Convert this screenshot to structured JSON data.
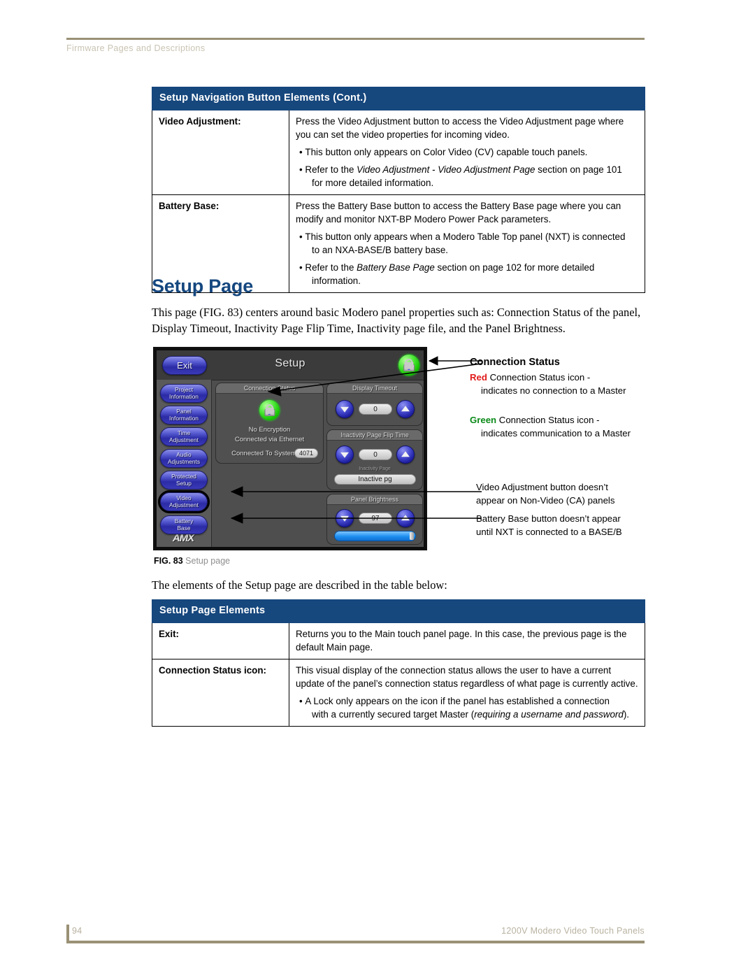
{
  "header": {
    "running_head": "Firmware Pages and Descriptions"
  },
  "footer": {
    "page_number": "94",
    "doc_title": "1200V Modero Video Touch Panels"
  },
  "table_top": {
    "header": "Setup Navigation Button Elements (Cont.)",
    "rows": [
      {
        "label": "Video Adjustment:",
        "paragraphs": [
          "Press the Video Adjustment button to access the Video Adjustment page where you can set the video properties for incoming video."
        ],
        "bullets": [
          {
            "text": "This button only appears on Color Video (CV) capable touch panels."
          },
          {
            "pre": "Refer to the ",
            "italic": "Video Adjustment - Video Adjustment Page",
            "post": " section on page 101",
            "cont": "for more detailed information."
          }
        ]
      },
      {
        "label": "Battery Base:",
        "paragraphs": [
          "Press the Battery Base button to access the Battery Base page where you can modify and monitor NXT-BP Modero Power Pack parameters."
        ],
        "bullets": [
          {
            "text": "This button only appears when a Modero Table Top panel (NXT) is connected",
            "cont": "to an NXA-BASE/B battery base."
          },
          {
            "pre": "Refer to the ",
            "italic": "Battery Base Page",
            "post": " section on page 102 for more detailed",
            "cont": "information."
          }
        ]
      }
    ]
  },
  "section": {
    "heading": "Setup Page",
    "intro": "This page (FIG. 83) centers around basic Modero panel properties such as: Connection Status of the panel, Display Timeout, Inactivity Page Flip Time, Inactivity page file, and the Panel Brightness.",
    "table_lead": "The elements of the Setup page are described in the table below:"
  },
  "figure": {
    "caption_label": "FIG. 83",
    "caption_text": "Setup page",
    "panel": {
      "exit_button": "Exit",
      "title": "Setup",
      "status_lock_icon": "green-lock-icon",
      "nav_buttons": [
        {
          "line1": "Project",
          "line2": "Information",
          "selected": false
        },
        {
          "line1": "Panel",
          "line2": "Information",
          "selected": false
        },
        {
          "line1": "Time",
          "line2": "Adjustment",
          "selected": false
        },
        {
          "line1": "Audio",
          "line2": "Adjustments",
          "selected": false
        },
        {
          "line1": "Protected",
          "line2": "Setup",
          "selected": false
        },
        {
          "line1": "Video",
          "line2": "Adjustment",
          "selected": true
        },
        {
          "line1": "Battery",
          "line2": "Base",
          "selected": false
        }
      ],
      "brand": "AMX",
      "connection_status": {
        "title": "Connection Status",
        "encryption": "No Encryption",
        "transport": "Connected via Ethernet",
        "system_label": "Connected To System",
        "system_value": "4071"
      },
      "display_timeout": {
        "title": "Display Timeout",
        "value": "0"
      },
      "inactivity_page_flip": {
        "title": "Inactivity Page Flip Time",
        "value": "0",
        "page_label": "Inactivity Page",
        "page_value": "Inactive pg"
      },
      "panel_brightness": {
        "title": "Panel Brightness",
        "value": "97",
        "slider_percent": 97
      }
    },
    "callouts": {
      "status_title": "Connection Status",
      "red_word": "Red",
      "red_text": " Connection Status icon -",
      "red_text2": "indicates no connection to a Master",
      "green_word": "Green",
      "green_text": " Connection Status icon -",
      "green_text2": "indicates communication to a Master",
      "video_line1": "Video Adjustment button doesn’t",
      "video_line2": "appear on Non-Video (CA) panels",
      "battery_line1": "Battery Base button doesn’t appear",
      "battery_line2": "until NXT is connected to a BASE/B"
    }
  },
  "table_bottom": {
    "header": "Setup Page Elements",
    "rows": [
      {
        "label": "Exit:",
        "paragraphs": [
          "Returns you to the Main touch panel page. In this case, the previous page is the default Main page."
        ],
        "bullets": []
      },
      {
        "label": "Connection Status icon:",
        "paragraphs": [
          "This visual display of the connection status allows the user to have a current update of the panel’s connection status regardless of what page is currently active."
        ],
        "bullets": [
          {
            "pre": "A Lock only appears on the icon if the panel has established a connection",
            "cont_pre": "with a currently secured target Master (",
            "cont_italic": "requiring a username and password",
            "cont_post": ")."
          }
        ]
      }
    ]
  },
  "colors": {
    "table_header_blue": "#16477d",
    "heading_blue": "#15477f",
    "rule_tan": "#9a9176",
    "red": "#e21b1b",
    "green": "#0a8a18"
  }
}
